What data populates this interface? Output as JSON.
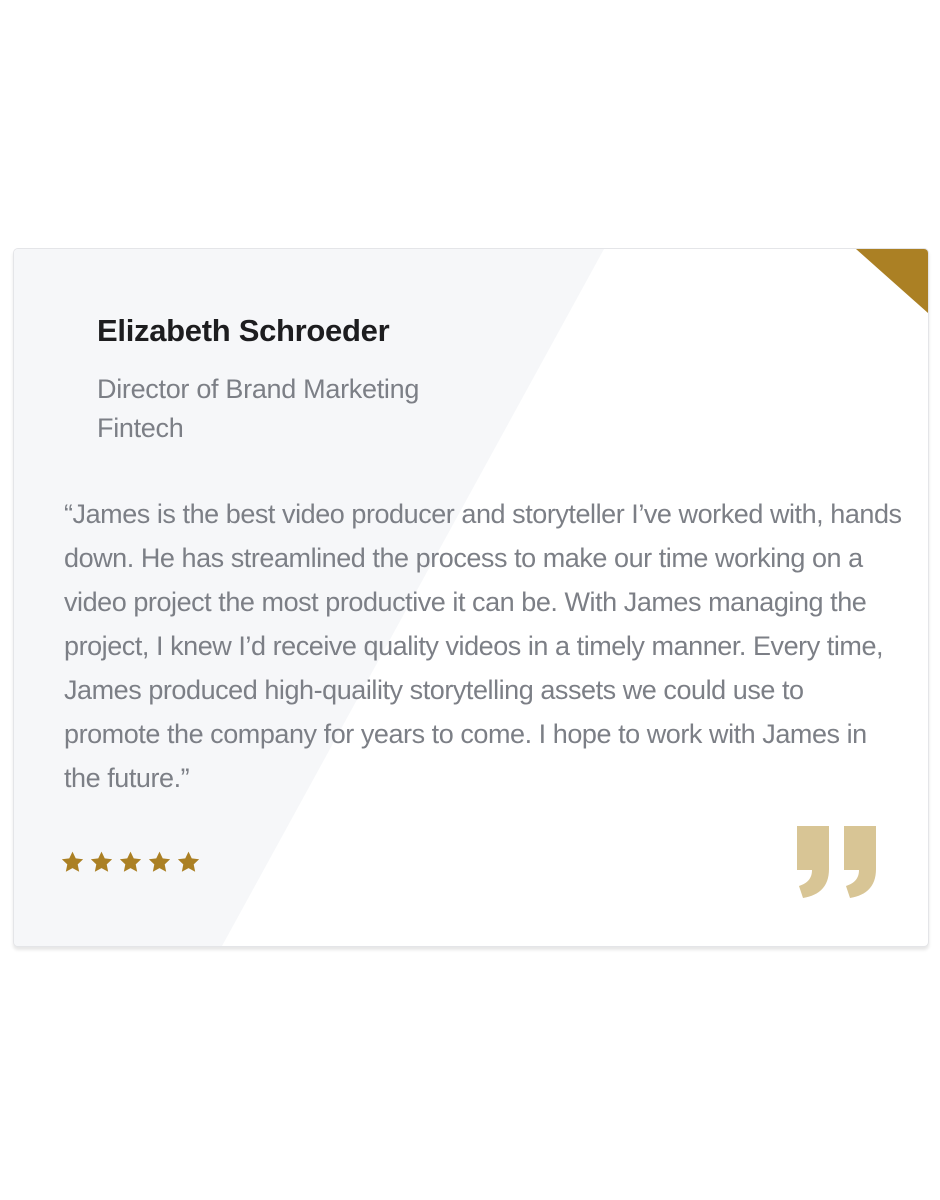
{
  "testimonial": {
    "name": "Elizabeth Schroeder",
    "role": "Director of Brand Marketing",
    "company": "Fintech",
    "quote": "“James is the best video producer and storyteller I’ve worked with, hands down. He has streamlined the process to make our time working on a video project the most productive it can be. With James managing the project, I knew I’d receive quality videos in a timely manner. Every time, James produced high-quaility storytelling assets we could use to promote the company for years to come. I hope to work with James in the future.”",
    "rating": 5,
    "rating_max": 5,
    "icons": {
      "stars": "star-icon",
      "quote_mark": "closing-quote-icon",
      "corner": "corner-ribbon"
    }
  },
  "colors": {
    "accent_gold": "#ab8024",
    "quote_mark": "#d8c595",
    "card_panel": "#f6f7f9",
    "name_text": "#1d1d1f",
    "body_text": "#7c7f86"
  }
}
